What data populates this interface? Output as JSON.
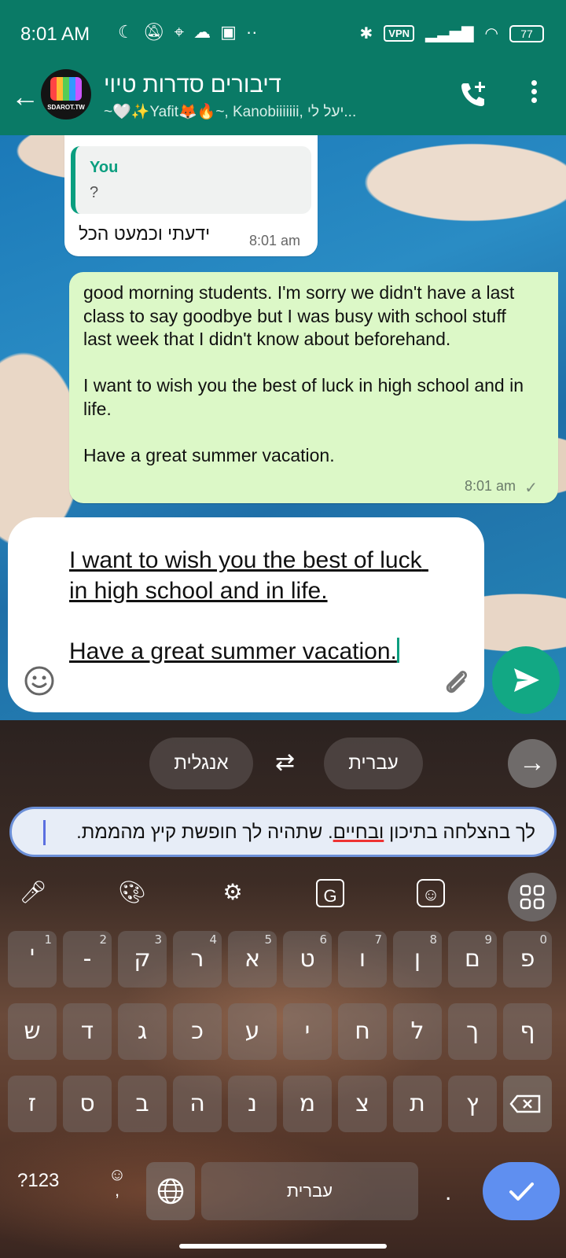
{
  "status_bar": {
    "time": "8:01 AM",
    "left_icons": [
      "moon-icon",
      "bell-off-icon",
      "location-icon",
      "cloud-icon",
      "app-icon",
      "more-dots-icon"
    ],
    "vpn": "VPN",
    "battery": "77"
  },
  "header": {
    "title": "דיבורים סדרות טיוי",
    "subtitle": "~🤍✨Yafit🦊🔥~, Kanobiiiiiii, יעל לי..."
  },
  "messages": {
    "incoming": {
      "quote_author": "You",
      "quote_text": "?",
      "text": "ידעתי וכמעט הכל",
      "time": "8:01 am"
    },
    "outgoing": {
      "text": "good morning students. I'm sorry we didn't have a last class to say goodbye but I was busy with school stuff last week that I didn't know about beforehand.\n\nI want to wish you the best of luck in high school and in life.\n\nHave a great summer vacation.",
      "time": "8:01 am",
      "status": "✓"
    }
  },
  "composer": {
    "text": "I want to wish you the best of luck in high school and in life.\n\nHave a great summer vacation."
  },
  "translate": {
    "source_lang": "אנגלית",
    "target_lang": "עברית",
    "text_before": "לך בהצלחה בתיכון ",
    "text_misspelled": "ובחיים",
    "text_after": ".  שתהיה לך חופשת קיץ מהממת."
  },
  "keyboard": {
    "row1": [
      {
        "k": "פ",
        "n": "0"
      },
      {
        "k": "ם",
        "n": "9"
      },
      {
        "k": "ן",
        "n": "8"
      },
      {
        "k": "ו",
        "n": "7"
      },
      {
        "k": "ט",
        "n": "6"
      },
      {
        "k": "א",
        "n": "5"
      },
      {
        "k": "ר",
        "n": "4"
      },
      {
        "k": "ק",
        "n": "3"
      },
      {
        "k": "-",
        "n": "2"
      },
      {
        "k": "'",
        "n": "1"
      }
    ],
    "row2": [
      "ף",
      "ך",
      "ל",
      "ח",
      "י",
      "ע",
      "כ",
      "ג",
      "ד",
      "ש"
    ],
    "row3": [
      "ץ",
      "ת",
      "צ",
      "מ",
      "נ",
      "ה",
      "ב",
      "ס",
      "ז"
    ],
    "num_label": "?123",
    "comma": ",",
    "space_label": "עברית",
    "period": "."
  }
}
